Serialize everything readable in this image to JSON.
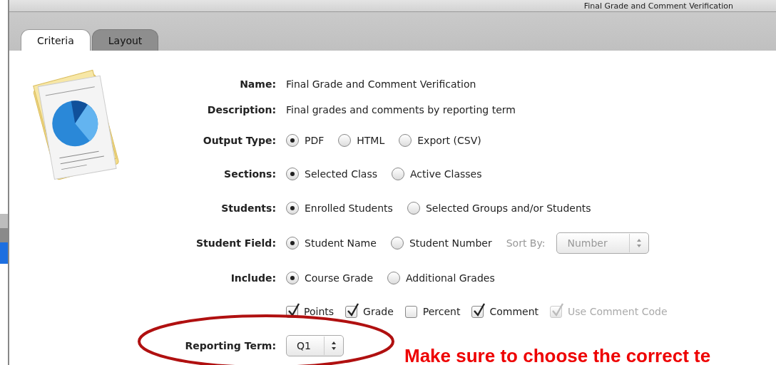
{
  "window": {
    "title": "Final Grade and Comment Verification"
  },
  "tabs": [
    {
      "label": "Criteria",
      "selected": true
    },
    {
      "label": "Layout",
      "selected": false
    }
  ],
  "rows": [
    {
      "kind": "text",
      "label": "Name:",
      "value": "Final Grade and Comment Verification"
    },
    {
      "kind": "text",
      "label": "Description:",
      "value": "Final grades and comments by reporting term"
    },
    {
      "kind": "radio",
      "label": "Output Type:",
      "options": [
        {
          "label": "PDF",
          "selected": true
        },
        {
          "label": "HTML",
          "selected": false
        },
        {
          "label": "Export (CSV)",
          "selected": false
        }
      ]
    },
    {
      "kind": "radio",
      "label": "Sections:",
      "options": [
        {
          "label": "Selected Class",
          "selected": true
        },
        {
          "label": "Active Classes",
          "selected": false
        }
      ]
    },
    {
      "kind": "radio",
      "label": "Students:",
      "options": [
        {
          "label": "Enrolled Students",
          "selected": true
        },
        {
          "label": "Selected Groups and/or Students",
          "selected": false
        }
      ]
    },
    {
      "kind": "radio",
      "label": "Student Field:",
      "options": [
        {
          "label": "Student Name",
          "selected": true
        },
        {
          "label": "Student Number",
          "selected": false
        }
      ],
      "sort": {
        "label": "Sort By:",
        "value": "Number",
        "disabled": true
      }
    },
    {
      "kind": "radio",
      "label": "Include:",
      "options": [
        {
          "label": "Course Grade",
          "selected": true
        },
        {
          "label": "Additional Grades",
          "selected": false
        }
      ]
    },
    {
      "kind": "checks",
      "options": [
        {
          "label": "Points",
          "checked": true,
          "disabled": false
        },
        {
          "label": "Grade",
          "checked": true,
          "disabled": false
        },
        {
          "label": "Percent",
          "checked": false,
          "disabled": false
        },
        {
          "label": "Comment",
          "checked": true,
          "disabled": false
        },
        {
          "label": "Use Comment Code",
          "checked": true,
          "disabled": true
        }
      ]
    },
    {
      "kind": "select",
      "label": "Reporting Term:",
      "value": "Q1",
      "disabled": false
    }
  ],
  "annotation": {
    "text": "Make sure to choose the correct te"
  }
}
